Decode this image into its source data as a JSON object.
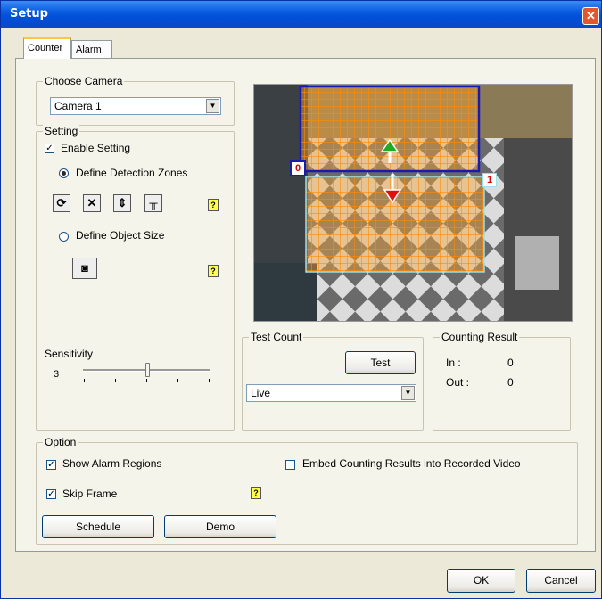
{
  "window": {
    "title": "Setup"
  },
  "tabs": [
    "Counter",
    "Alarm"
  ],
  "choose_camera": {
    "legend": "Choose Camera",
    "value": "Camera 1"
  },
  "setting": {
    "legend": "Setting",
    "enable_label": "Enable Setting",
    "define_zones_label": "Define Detection Zones",
    "define_size_label": "Define Object Size",
    "sensitivity_label": "Sensitivity",
    "sensitivity_value": "3",
    "sensitivity_level": 3
  },
  "video": {
    "zone_labels": [
      "0",
      "1"
    ]
  },
  "test_count": {
    "legend": "Test Count",
    "test_label": "Test",
    "mode": "Live"
  },
  "counting_result": {
    "legend": "Counting Result",
    "in_label": "In :",
    "in_value": "0",
    "out_label": "Out :",
    "out_value": "0"
  },
  "option": {
    "legend": "Option",
    "show_alarm": "Show Alarm Regions",
    "embed": "Embed Counting Results into Recorded Video",
    "skip_frame": "Skip Frame",
    "schedule": "Schedule",
    "demo": "Demo"
  },
  "footer": {
    "ok": "OK",
    "cancel": "Cancel"
  },
  "icons": [
    "refresh-icon",
    "delete-icon",
    "resize-icon",
    "tools-icon",
    "help-icon",
    "camera-icon",
    "close-icon",
    "dropdown-arrow-icon"
  ],
  "colors": {
    "titlebar": "#0b5ce0",
    "zone_border": "#1a1ab0",
    "zone_grid": "#ff8c00",
    "zone_label": "#e00000"
  }
}
